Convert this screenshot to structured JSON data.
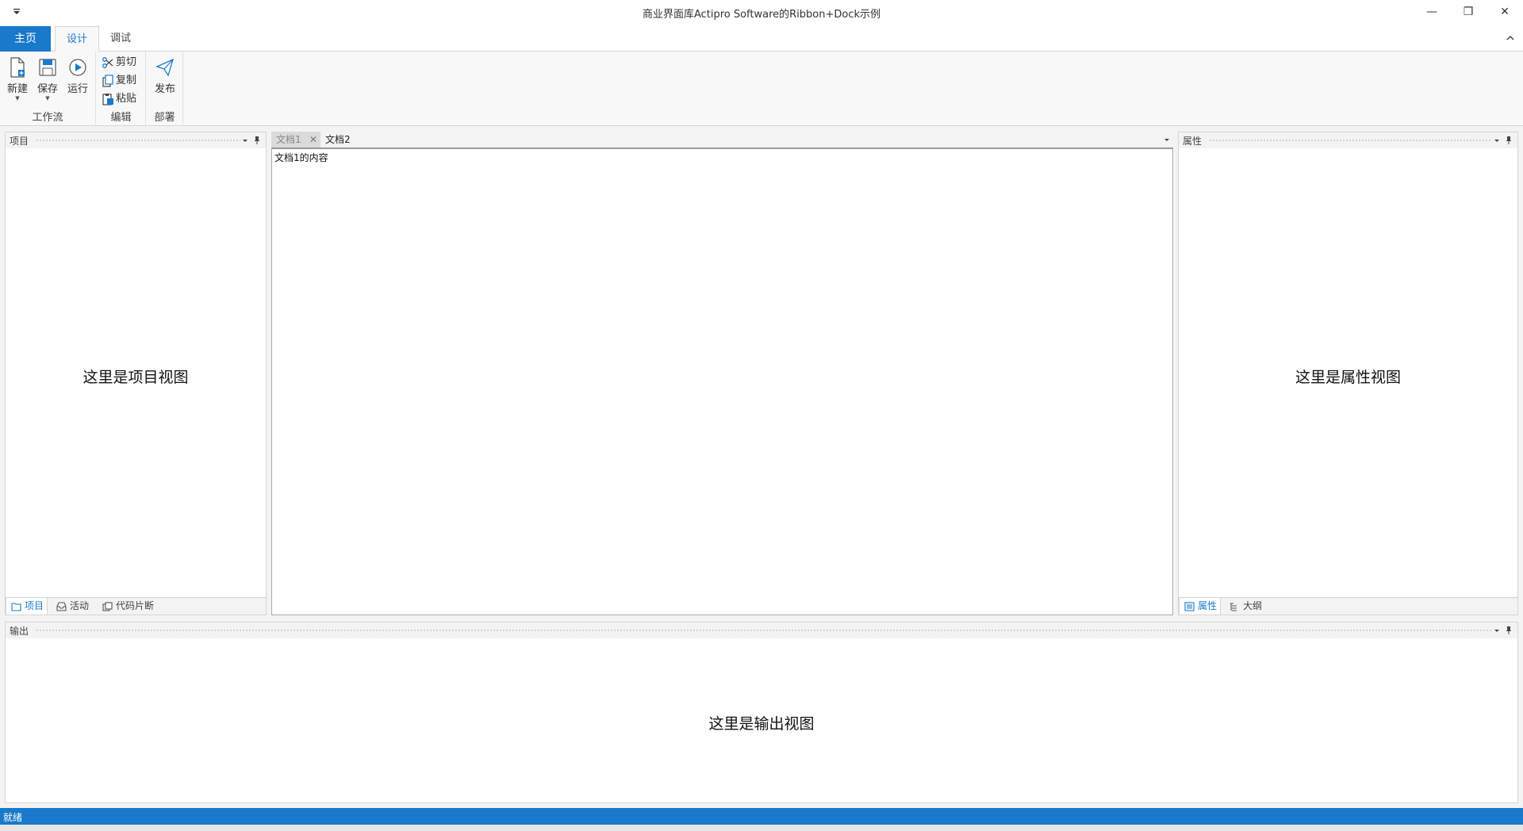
{
  "window": {
    "title": "商业界面库Actipro Software的Ribbon+Dock示例",
    "qat_icon": "dropdown-icon",
    "minimize_glyph": "—",
    "restore_glyph": "❐",
    "close_glyph": "✕"
  },
  "ribbon": {
    "app_tab": "主页",
    "tabs": [
      {
        "label": "设计",
        "active": true
      },
      {
        "label": "调试",
        "active": false
      }
    ],
    "groups": {
      "workflow": {
        "label": "工作流",
        "new": "新建",
        "save": "保存",
        "run": "运行"
      },
      "edit": {
        "label": "编辑",
        "cut": "剪切",
        "copy": "复制",
        "paste": "粘贴"
      },
      "deploy": {
        "label": "部署",
        "publish": "发布"
      }
    }
  },
  "panels": {
    "project": {
      "title": "项目",
      "content": "这里是项目视图",
      "tabs": [
        "项目",
        "活动",
        "代码片断"
      ]
    },
    "documents": {
      "tabs": [
        "文档1",
        "文档2"
      ],
      "close_glyph": "✕",
      "content": "文档1的内容"
    },
    "properties": {
      "title": "属性",
      "content": "这里是属性视图",
      "tabs": [
        "属性",
        "大纲"
      ]
    },
    "output": {
      "title": "输出",
      "content": "这里是输出视图"
    }
  },
  "status": {
    "text": "就绪"
  },
  "colors": {
    "accent": "#1979ca",
    "panel_bg": "#ffffff",
    "chrome_bg": "#f3f3f3"
  }
}
